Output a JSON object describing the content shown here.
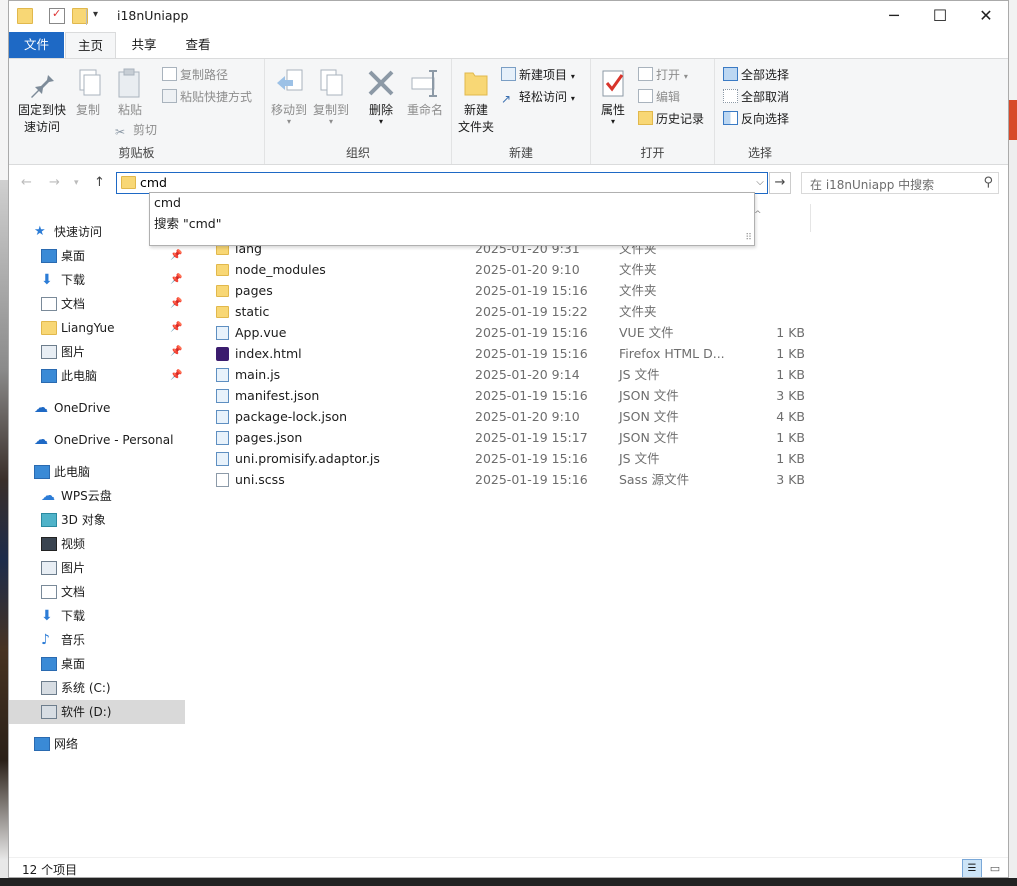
{
  "window": {
    "title": "i18nUniapp",
    "minimize": "─",
    "maximize": "☐",
    "close": "✕"
  },
  "tabs": [
    {
      "label": "文件"
    },
    {
      "label": "主页"
    },
    {
      "label": "共享"
    },
    {
      "label": "查看"
    }
  ],
  "ribbon": {
    "clipboard": {
      "pin": "固定到快\n速访问",
      "copy": "复制",
      "paste": "粘贴",
      "copy_path": "复制路径",
      "paste_shortcut": "粘贴快捷方式",
      "cut": "剪切",
      "label": "剪贴板"
    },
    "organize": {
      "move_to": "移动到",
      "copy_to": "复制到",
      "delete": "删除",
      "rename": "重命名",
      "label": "组织"
    },
    "new": {
      "new_folder": "新建\n文件夹",
      "new_item": "新建项目",
      "easy_access": "轻松访问",
      "label": "新建"
    },
    "open": {
      "properties": "属性",
      "open": "打开",
      "edit": "编辑",
      "history": "历史记录",
      "label": "打开"
    },
    "select": {
      "select_all": "全部选择",
      "select_none": "全部取消",
      "invert": "反向选择",
      "label": "选择"
    }
  },
  "address": {
    "value": "cmd",
    "search_placeholder": "在 i18nUniapp 中搜索"
  },
  "suggestions": [
    "cmd",
    "搜索 \"cmd\""
  ],
  "nav": {
    "quick_access": "快速访问",
    "qa_items": [
      "桌面",
      "下载",
      "文档",
      "LiangYue",
      "图片",
      "此电脑"
    ],
    "onedrive": "OneDrive",
    "onedrive_personal": "OneDrive - Personal",
    "this_pc": "此电脑",
    "pc_items": [
      "WPS云盘",
      "3D 对象",
      "视频",
      "图片",
      "文档",
      "下载",
      "音乐",
      "桌面",
      "系统 (C:)",
      "软件 (D:)"
    ],
    "network": "网络"
  },
  "files": [
    {
      "name": "lang",
      "date": "2025-01-20 9:31",
      "type": "文件夹",
      "size": "",
      "icon": "folder"
    },
    {
      "name": "node_modules",
      "date": "2025-01-20 9:10",
      "type": "文件夹",
      "size": "",
      "icon": "folder"
    },
    {
      "name": "pages",
      "date": "2025-01-19 15:16",
      "type": "文件夹",
      "size": "",
      "icon": "folder"
    },
    {
      "name": "static",
      "date": "2025-01-19 15:22",
      "type": "文件夹",
      "size": "",
      "icon": "folder"
    },
    {
      "name": "App.vue",
      "date": "2025-01-19 15:16",
      "type": "VUE 文件",
      "size": "1 KB",
      "icon": "json"
    },
    {
      "name": "index.html",
      "date": "2025-01-19 15:16",
      "type": "Firefox HTML D...",
      "size": "1 KB",
      "icon": "ff"
    },
    {
      "name": "main.js",
      "date": "2025-01-20 9:14",
      "type": "JS 文件",
      "size": "1 KB",
      "icon": "json"
    },
    {
      "name": "manifest.json",
      "date": "2025-01-19 15:16",
      "type": "JSON 文件",
      "size": "3 KB",
      "icon": "json"
    },
    {
      "name": "package-lock.json",
      "date": "2025-01-20 9:10",
      "type": "JSON 文件",
      "size": "4 KB",
      "icon": "json"
    },
    {
      "name": "pages.json",
      "date": "2025-01-19 15:17",
      "type": "JSON 文件",
      "size": "1 KB",
      "icon": "json"
    },
    {
      "name": "uni.promisify.adaptor.js",
      "date": "2025-01-19 15:16",
      "type": "JS 文件",
      "size": "1 KB",
      "icon": "json"
    },
    {
      "name": "uni.scss",
      "date": "2025-01-19 15:16",
      "type": "Sass 源文件",
      "size": "3 KB",
      "icon": "doc"
    }
  ],
  "status": {
    "count": "12 个项目"
  }
}
